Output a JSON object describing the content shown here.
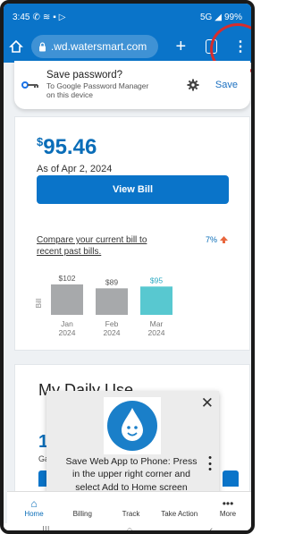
{
  "status_bar": {
    "time": "3:45",
    "network": "5G",
    "battery": "99%"
  },
  "url_bar": {
    "url": ".wd.watersmart.com"
  },
  "password_prompt": {
    "title": "Save password?",
    "subtitle_line1": "To Google Password Manager",
    "subtitle_line2": "on this device",
    "save_label": "Save"
  },
  "bill": {
    "currency": "$",
    "amount": "95.46",
    "as_of": "As of Apr 2, 2024",
    "view_bill_label": "View Bill",
    "compare_line1": "Compare your current bill to",
    "compare_line2": "recent past bills.",
    "percent_change": "7%"
  },
  "chart_data": {
    "type": "bar",
    "ylabel": "Bill",
    "categories": [
      "Jan\n2024",
      "Feb\n2024",
      "Mar\n2024"
    ],
    "category_months": [
      "Jan",
      "Feb",
      "Mar"
    ],
    "category_years": [
      "2024",
      "2024",
      "2024"
    ],
    "values": [
      102,
      89,
      95
    ],
    "value_labels": [
      "$102",
      "$89",
      "$95"
    ],
    "colors": [
      "#a7a9ab",
      "#a7a9ab",
      "#58c8d0"
    ]
  },
  "daily_use": {
    "title": "My Daily Use",
    "number_partial": "1",
    "sub_partial": "Ga"
  },
  "install_popup": {
    "line1": "Save Web App to Phone: Press",
    "line2": "in the upper right corner and",
    "line3": "select Add to Home screen"
  },
  "bottom_nav": [
    {
      "label": "Home",
      "icon": "home-icon"
    },
    {
      "label": "Billing",
      "icon": "billing-icon"
    },
    {
      "label": "Track",
      "icon": "track-icon"
    },
    {
      "label": "Take Action",
      "icon": "take-action-icon"
    },
    {
      "label": "More",
      "icon": "more-icon"
    }
  ]
}
